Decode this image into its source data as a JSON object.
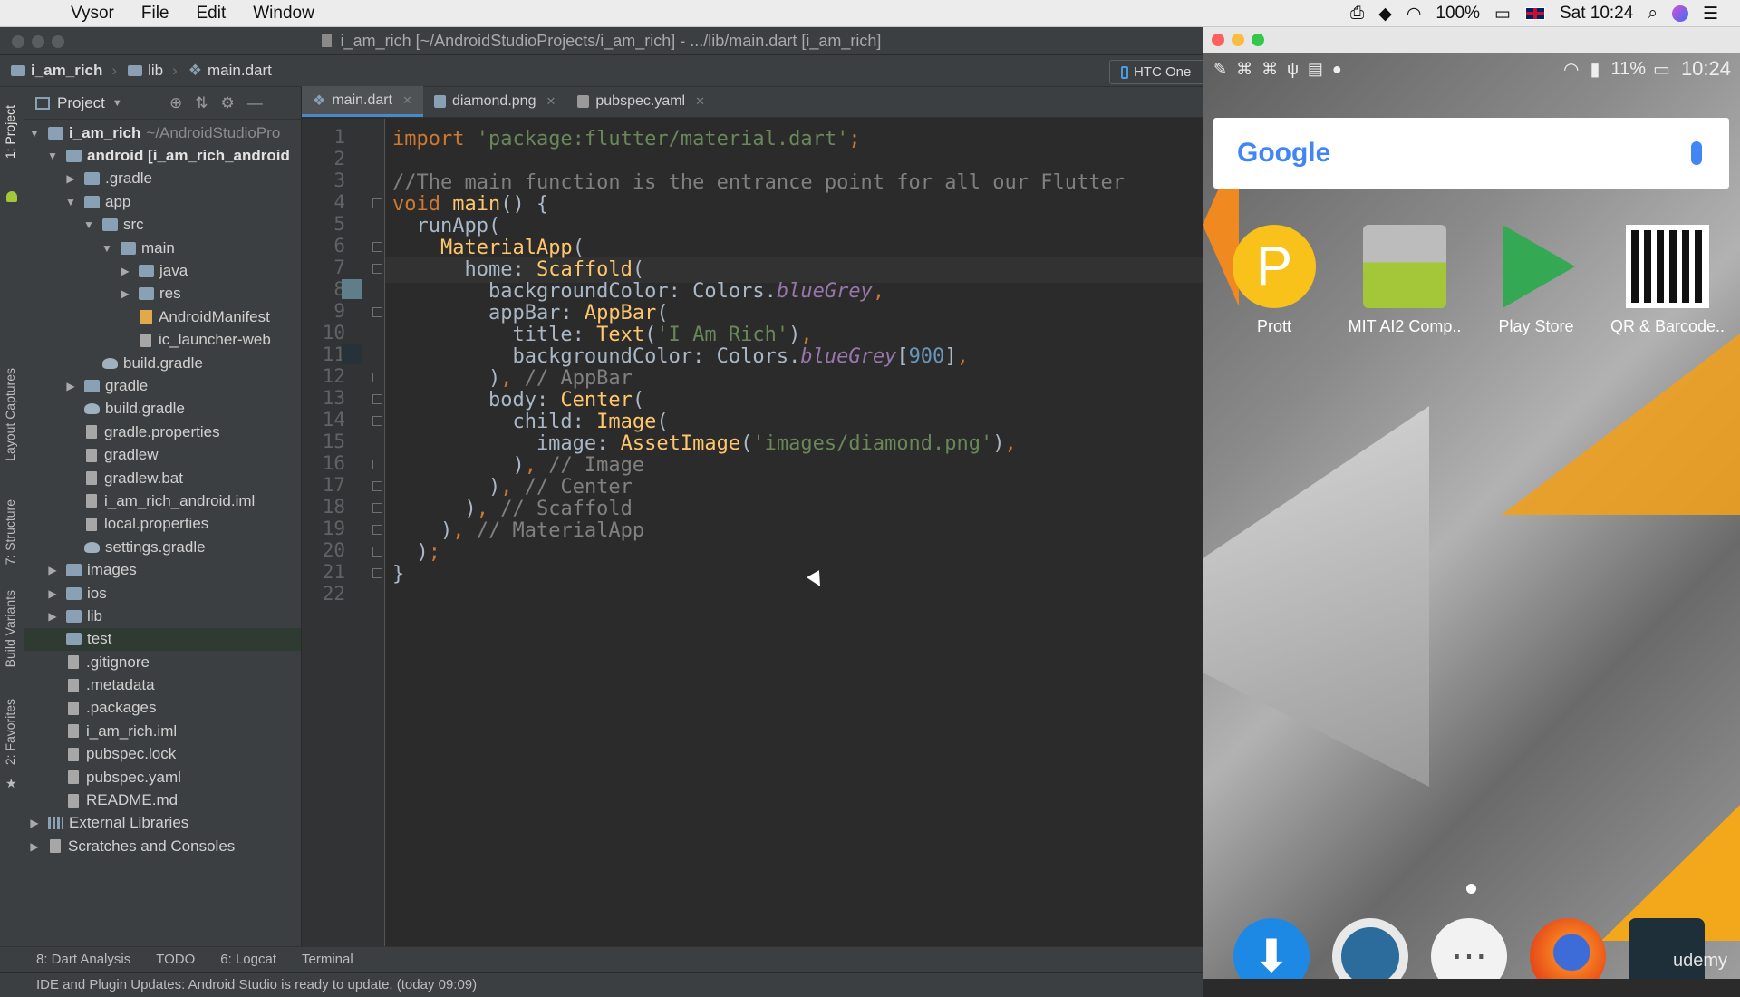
{
  "menubar": {
    "app_name": "Vysor",
    "menus": [
      "File",
      "Edit",
      "Window"
    ],
    "battery": "100%",
    "datetime": "Sat 10:24"
  },
  "ide": {
    "window_title": "i_am_rich [~/AndroidStudioProjects/i_am_rich] - .../lib/main.dart [i_am_rich]",
    "breadcrumbs": [
      "i_am_rich",
      "lib",
      "main.dart"
    ],
    "device": "HTC One",
    "project_panel_title": "Project",
    "side_tabs": [
      "1: Project",
      "Layout Captures",
      "7: Structure",
      "Build Variants",
      "2: Favorites"
    ],
    "tree": [
      {
        "label": "i_am_rich",
        "extra": "~/AndroidStudioPro",
        "depth": 0,
        "arrow": "open",
        "icon": "folder",
        "bold": true
      },
      {
        "label": "android [i_am_rich_android",
        "depth": 1,
        "arrow": "open",
        "icon": "folder",
        "bold": true
      },
      {
        "label": ".gradle",
        "depth": 2,
        "arrow": "closed",
        "icon": "folder"
      },
      {
        "label": "app",
        "depth": 2,
        "arrow": "open",
        "icon": "folder"
      },
      {
        "label": "src",
        "depth": 3,
        "arrow": "open",
        "icon": "folder"
      },
      {
        "label": "main",
        "depth": 4,
        "arrow": "open",
        "icon": "folder"
      },
      {
        "label": "java",
        "depth": 5,
        "arrow": "closed",
        "icon": "folder"
      },
      {
        "label": "res",
        "depth": 5,
        "arrow": "closed",
        "icon": "folder"
      },
      {
        "label": "AndroidManifest",
        "depth": 5,
        "arrow": "none",
        "icon": "xml"
      },
      {
        "label": "ic_launcher-web",
        "depth": 5,
        "arrow": "none",
        "icon": "file"
      },
      {
        "label": "build.gradle",
        "depth": 3,
        "arrow": "none",
        "icon": "gradle"
      },
      {
        "label": "gradle",
        "depth": 2,
        "arrow": "closed",
        "icon": "folder"
      },
      {
        "label": "build.gradle",
        "depth": 2,
        "arrow": "none",
        "icon": "gradle"
      },
      {
        "label": "gradle.properties",
        "depth": 2,
        "arrow": "none",
        "icon": "file"
      },
      {
        "label": "gradlew",
        "depth": 2,
        "arrow": "none",
        "icon": "file"
      },
      {
        "label": "gradlew.bat",
        "depth": 2,
        "arrow": "none",
        "icon": "file"
      },
      {
        "label": "i_am_rich_android.iml",
        "depth": 2,
        "arrow": "none",
        "icon": "file"
      },
      {
        "label": "local.properties",
        "depth": 2,
        "arrow": "none",
        "icon": "file"
      },
      {
        "label": "settings.gradle",
        "depth": 2,
        "arrow": "none",
        "icon": "gradle"
      },
      {
        "label": "images",
        "depth": 1,
        "arrow": "closed",
        "icon": "folder"
      },
      {
        "label": "ios",
        "depth": 1,
        "arrow": "closed",
        "icon": "folder"
      },
      {
        "label": "lib",
        "depth": 1,
        "arrow": "closed",
        "icon": "folder"
      },
      {
        "label": "test",
        "depth": 1,
        "arrow": "none",
        "icon": "folder",
        "selected": true
      },
      {
        "label": ".gitignore",
        "depth": 1,
        "arrow": "none",
        "icon": "file"
      },
      {
        "label": ".metadata",
        "depth": 1,
        "arrow": "none",
        "icon": "file"
      },
      {
        "label": ".packages",
        "depth": 1,
        "arrow": "none",
        "icon": "file"
      },
      {
        "label": "i_am_rich.iml",
        "depth": 1,
        "arrow": "none",
        "icon": "file"
      },
      {
        "label": "pubspec.lock",
        "depth": 1,
        "arrow": "none",
        "icon": "file"
      },
      {
        "label": "pubspec.yaml",
        "depth": 1,
        "arrow": "none",
        "icon": "file"
      },
      {
        "label": "README.md",
        "depth": 1,
        "arrow": "none",
        "icon": "file"
      },
      {
        "label": "External Libraries",
        "depth": 0,
        "arrow": "closed",
        "icon": "ext"
      },
      {
        "label": "Scratches and Consoles",
        "depth": 0,
        "arrow": "closed",
        "icon": "file"
      }
    ],
    "tabs": [
      {
        "label": "main.dart",
        "active": true
      },
      {
        "label": "diamond.png",
        "active": false
      },
      {
        "label": "pubspec.yaml",
        "active": false
      }
    ],
    "code_lines": [
      [
        [
          "kw",
          "import "
        ],
        [
          "str",
          "'package:flutter/material.dart'"
        ],
        [
          "kw",
          ";"
        ]
      ],
      [],
      [
        [
          "cm",
          "//The main function is the entrance point for all our Flutter"
        ]
      ],
      [
        [
          "kw",
          "void "
        ],
        [
          "fn",
          "main"
        ],
        [
          "txt",
          "() {"
        ]
      ],
      [
        [
          "txt",
          "  runApp("
        ]
      ],
      [
        [
          "txt",
          "    "
        ],
        [
          "fn",
          "MaterialApp"
        ],
        [
          "txt",
          "("
        ]
      ],
      [
        [
          "txt",
          "      home: "
        ],
        [
          "fn",
          "Scaffold"
        ],
        [
          "txt",
          "("
        ]
      ],
      [
        [
          "txt",
          "        backgroundColor: Colors."
        ],
        [
          "it",
          "blueGrey"
        ],
        [
          "kw",
          ","
        ]
      ],
      [
        [
          "txt",
          "        appBar: "
        ],
        [
          "fn",
          "AppBar"
        ],
        [
          "txt",
          "("
        ]
      ],
      [
        [
          "txt",
          "          title: "
        ],
        [
          "fn",
          "Text"
        ],
        [
          "txt",
          "("
        ],
        [
          "str",
          "'I Am Rich'"
        ],
        [
          "txt",
          ")"
        ],
        [
          "kw",
          ","
        ]
      ],
      [
        [
          "txt",
          "          backgroundColor: Colors."
        ],
        [
          "it",
          "blueGrey"
        ],
        [
          "txt",
          "["
        ],
        [
          "num",
          "900"
        ],
        [
          "txt",
          "]"
        ],
        [
          "kw",
          ","
        ]
      ],
      [
        [
          "txt",
          "        )"
        ],
        [
          "kw",
          ","
        ],
        [
          "cm",
          " // AppBar"
        ]
      ],
      [
        [
          "txt",
          "        body: "
        ],
        [
          "fn",
          "Center"
        ],
        [
          "txt",
          "("
        ]
      ],
      [
        [
          "txt",
          "          child: "
        ],
        [
          "fn",
          "Image"
        ],
        [
          "txt",
          "("
        ]
      ],
      [
        [
          "txt",
          "            image: "
        ],
        [
          "fn",
          "AssetImage"
        ],
        [
          "txt",
          "("
        ],
        [
          "str",
          "'images/diamond.png'"
        ],
        [
          "txt",
          ")"
        ],
        [
          "kw",
          ","
        ]
      ],
      [
        [
          "txt",
          "          )"
        ],
        [
          "kw",
          ","
        ],
        [
          "cm",
          " // Image"
        ]
      ],
      [
        [
          "txt",
          "        )"
        ],
        [
          "kw",
          ","
        ],
        [
          "cm",
          " // Center"
        ]
      ],
      [
        [
          "txt",
          "      )"
        ],
        [
          "kw",
          ","
        ],
        [
          "cm",
          " // Scaffold"
        ]
      ],
      [
        [
          "txt",
          "    )"
        ],
        [
          "kw",
          ","
        ],
        [
          "cm",
          " // MaterialApp"
        ]
      ],
      [
        [
          "txt",
          "  )"
        ],
        [
          "kw",
          ";"
        ]
      ],
      [
        [
          "txt",
          "}"
        ]
      ],
      []
    ],
    "bottom_tools": [
      "8: Dart Analysis",
      "TODO",
      "6: Logcat",
      "Terminal"
    ],
    "status_text": "IDE and Plugin Updates: Android Studio is ready to update. (today 09:09)"
  },
  "phone": {
    "battery": "11%",
    "time": "10:24",
    "search_brand": "Google",
    "apps": [
      "Prott",
      "MIT AI2 Comp..",
      "Play Store",
      "QR & Barcode.."
    ],
    "watermark": "udemy"
  },
  "colors": {
    "ide_bg": "#2b2b2b",
    "panel_bg": "#3c3f41",
    "blue_grey_swatch": "#607d8b",
    "blue_grey_900_swatch": "#263238"
  }
}
